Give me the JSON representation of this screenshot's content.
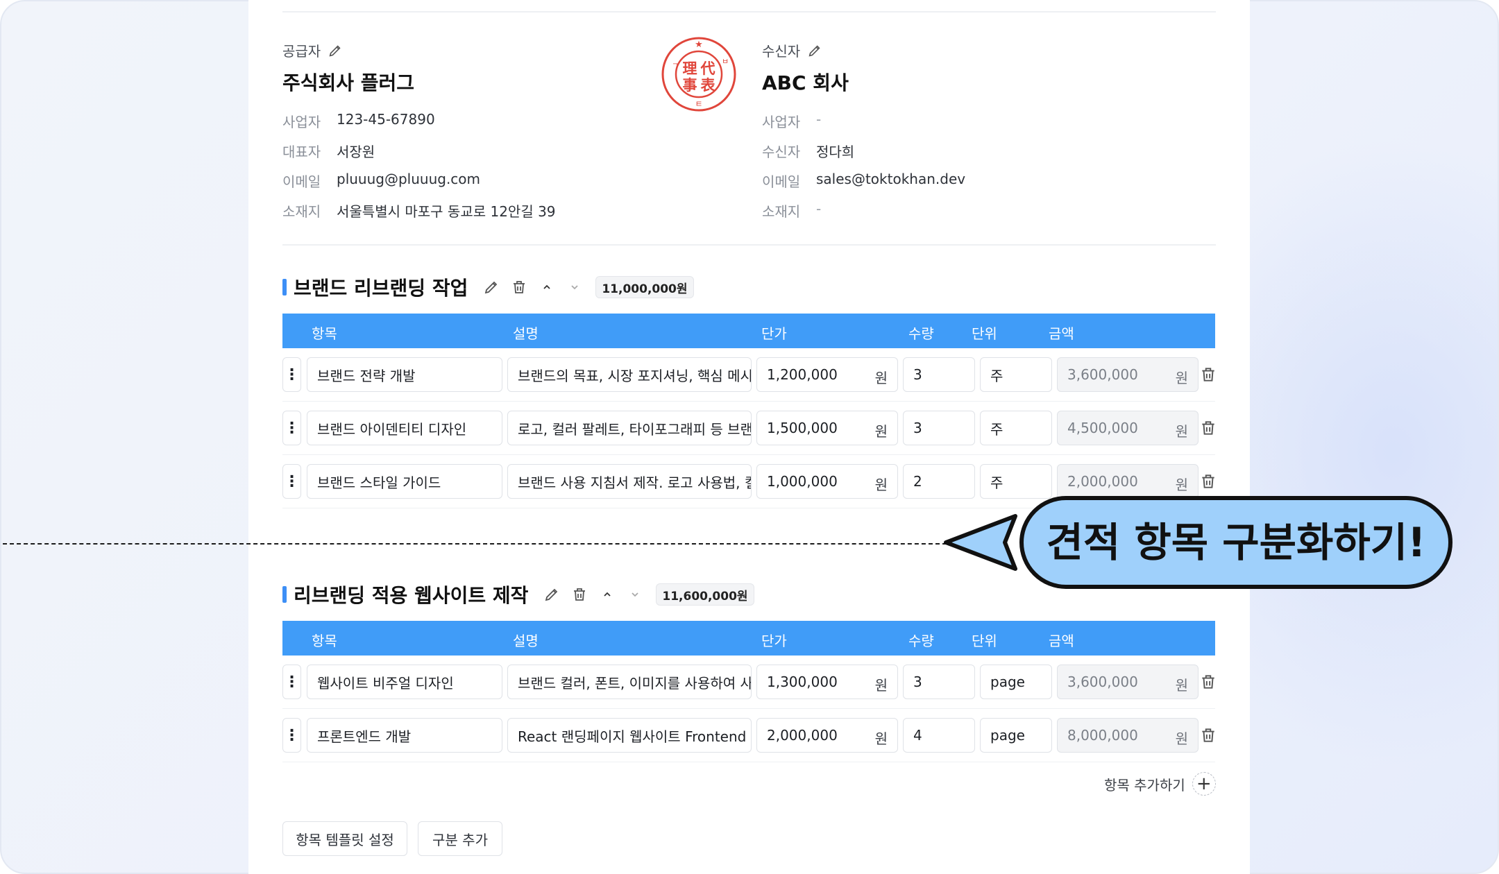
{
  "supplier": {
    "label": "공급자",
    "name": "주식회사 플러그",
    "rows": [
      {
        "key": "사업자",
        "value": "123-45-67890"
      },
      {
        "key": "대표자",
        "value": "서장원"
      },
      {
        "key": "이메일",
        "value": "pluuug@pluuug.com"
      },
      {
        "key": "소재지",
        "value": "서울특별시 마포구 동교로 12안길 39"
      }
    ]
  },
  "recipient": {
    "label": "수신자",
    "name": "ABC 회사",
    "rows": [
      {
        "key": "사업자",
        "value": "-"
      },
      {
        "key": "수신자",
        "value": "정다희"
      },
      {
        "key": "이메일",
        "value": "sales@toktokhan.dev"
      },
      {
        "key": "소재지",
        "value": "-"
      }
    ]
  },
  "stamp": {
    "chars": [
      "理",
      "代",
      "事",
      "表"
    ],
    "color": "#e0463b"
  },
  "table_headers": [
    "항목",
    "설명",
    "단가",
    "수량",
    "단위",
    "금액"
  ],
  "currency_unit": "원",
  "sections": [
    {
      "title": "브랜드 리브랜딩 작업",
      "total": "11,000,000원",
      "rows": [
        {
          "item": "브랜드 전략 개발",
          "desc": "브랜드의 목표, 시장 포지셔닝, 핵심 메시",
          "price": "1,200,000",
          "qty": "3",
          "unit": "주",
          "amount": "3,600,000"
        },
        {
          "item": "브랜드 아이덴티티 디자인",
          "desc": "로고, 컬러 팔레트, 타이포그래피 등 브랜",
          "price": "1,500,000",
          "qty": "3",
          "unit": "주",
          "amount": "4,500,000"
        },
        {
          "item": "브랜드 스타일 가이드",
          "desc": "브랜드 사용 지침서 제작. 로고 사용법, 컬",
          "price": "1,000,000",
          "qty": "2",
          "unit": "주",
          "amount": "2,000,000"
        }
      ]
    },
    {
      "title": "리브랜딩 적용 웹사이트 제작",
      "total": "11,600,000원",
      "rows": [
        {
          "item": "웹사이트 비주얼 디자인",
          "desc": "브랜드 컬러, 폰트, 이미지를 사용하여 사",
          "price": "1,300,000",
          "qty": "3",
          "unit": "page",
          "amount": "3,600,000"
        },
        {
          "item": "프론트엔드 개발",
          "desc": "React 랜딩페이지 웹사이트 Frontend",
          "price": "2,000,000",
          "qty": "4",
          "unit": "page",
          "amount": "8,000,000"
        }
      ]
    }
  ],
  "add_item_label": "항목 추가하기",
  "buttons": {
    "template": "항목 템플릿 설정",
    "add_section": "구분 추가"
  },
  "callout_text": "견적 항목 구분화하기!",
  "colors": {
    "accent": "#409cf8",
    "callout_fill": "#9fd0fb",
    "stamp": "#e0463b"
  }
}
